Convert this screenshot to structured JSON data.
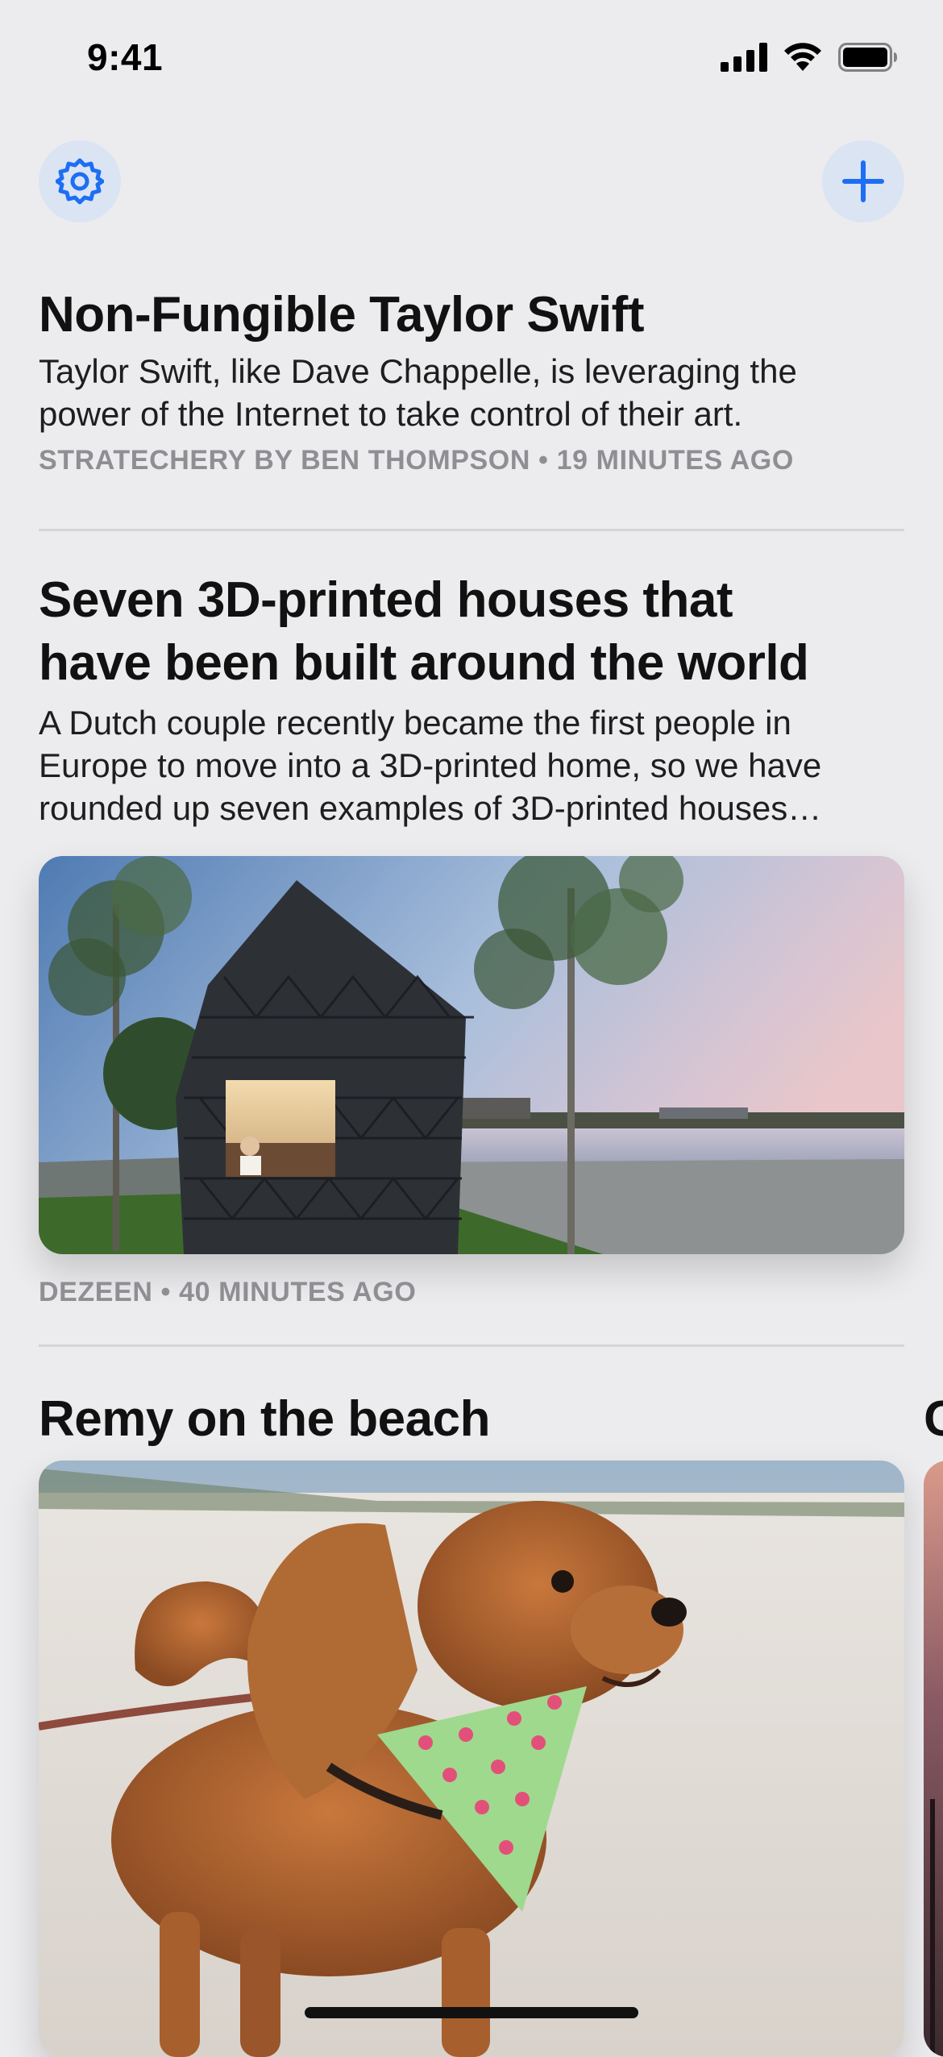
{
  "status_bar": {
    "time": "9:41",
    "icons": [
      "signal-icon",
      "wifi-icon",
      "battery-icon"
    ]
  },
  "toolbar": {
    "settings_icon": "gear-icon",
    "add_icon": "plus-icon",
    "accent_color": "#1d6ef5",
    "button_bg": "#dbe4f3"
  },
  "articles": [
    {
      "headline": "Non-Fungible Taylor Swift",
      "summary_lines": [
        "Taylor Swift, like Dave Chappelle, is leveraging the",
        "power of the Internet to take control of their art."
      ],
      "meta": "STRATECHERY BY BEN THOMPSON • 19 MINUTES AGO"
    },
    {
      "headline_lines": [
        "Seven 3D-printed houses that",
        "have been built around the world"
      ],
      "summary_lines": [
        "A Dutch couple recently became the first people in",
        "Europe to move into a 3D-printed home, so we have",
        "rounded up seven examples of 3D-printed houses…"
      ],
      "image": "3d-printed-house-photo",
      "meta": "DEZEEN • 40 MINUTES AGO"
    }
  ],
  "photo_section": {
    "title": "Remy on the beach",
    "peek_title": "C",
    "image": "dog-on-beach-photo"
  }
}
